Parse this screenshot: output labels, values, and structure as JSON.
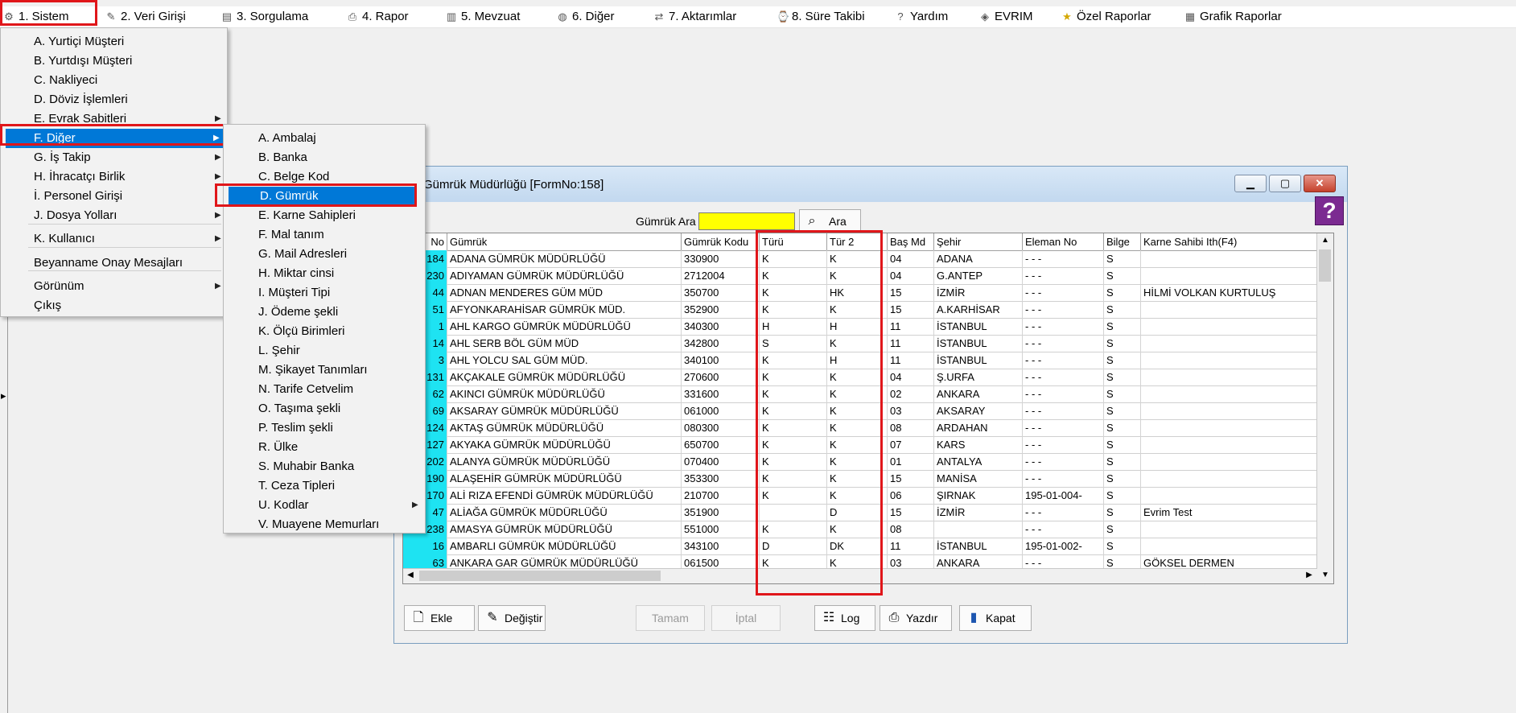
{
  "menubar": {
    "items": [
      {
        "label": "1.  Sistem",
        "icon": "system-icon"
      },
      {
        "label": "2.  Veri Girişi",
        "icon": "data-entry-icon"
      },
      {
        "label": "3.  Sorgulama",
        "icon": "query-icon"
      },
      {
        "label": "4.  Rapor",
        "icon": "printer-icon"
      },
      {
        "label": "5.  Mevzuat",
        "icon": "books-icon"
      },
      {
        "label": "6.  Diğer",
        "icon": "other-icon"
      },
      {
        "label": "7.  Aktarımlar",
        "icon": "transfer-icon"
      },
      {
        "label": "8. Süre Takibi",
        "icon": "timer-icon"
      },
      {
        "label": "Yardım",
        "icon": "help-icon"
      },
      {
        "label": "EVRIM",
        "icon": "evrim-icon"
      },
      {
        "label": "Özel Raporlar",
        "icon": "star-icon"
      },
      {
        "label": "Grafik Raporlar",
        "icon": "chart-icon"
      }
    ]
  },
  "system_menu": {
    "items": [
      {
        "label": "A.  Yurtiçi Müşteri"
      },
      {
        "label": "B.  Yurtdışı Müşteri"
      },
      {
        "label": "C.  Nakliyeci"
      },
      {
        "label": "D.  Döviz İşlemleri"
      },
      {
        "label": "E.  Evrak Sabitleri"
      },
      {
        "label": "F.  Diğer"
      },
      {
        "label": "G.  İş Takip"
      },
      {
        "label": "H.  İhracatçı Birlik"
      },
      {
        "label": "İ.    Personel Girişi"
      },
      {
        "label": "J.   Dosya Yolları"
      },
      {
        "label": "K.  Kullanıcı"
      },
      {
        "label": "Beyanname Onay Mesajları"
      },
      {
        "label": "Görünüm"
      },
      {
        "label": "Çıkış"
      }
    ]
  },
  "other_menu": {
    "items": [
      {
        "label": "A.  Ambalaj"
      },
      {
        "label": "B.  Banka"
      },
      {
        "label": "C.  Belge Kod"
      },
      {
        "label": "D.  Gümrük"
      },
      {
        "label": "E.  Karne Sahipleri"
      },
      {
        "label": "F.  Mal tanım"
      },
      {
        "label": "G.  Mail Adresleri"
      },
      {
        "label": "H.  Miktar cinsi"
      },
      {
        "label": "I.  Müşteri Tipi"
      },
      {
        "label": "J.  Ödeme şekli"
      },
      {
        "label": "K.  Ölçü Birimleri"
      },
      {
        "label": "L.  Şehir"
      },
      {
        "label": "M.  Şikayet Tanımları"
      },
      {
        "label": "N.  Tarife Cetvelim"
      },
      {
        "label": "O.  Taşıma şekli"
      },
      {
        "label": "P.  Teslim şekli"
      },
      {
        "label": "R.  Ülke"
      },
      {
        "label": "S.  Muhabir Banka"
      },
      {
        "label": "T.  Ceza Tipleri"
      },
      {
        "label": "U. Kodlar"
      },
      {
        "label": "V. Muayene Memurları"
      }
    ]
  },
  "window": {
    "title": "Gümrük Müdürlüğü [FormNo:158]",
    "help_glyph": "?"
  },
  "search": {
    "label": "Gümrük Ara",
    "value": "",
    "button_label": "Ara"
  },
  "grid": {
    "columns": [
      "No",
      "Gümrük",
      "Gümrük Kodu",
      "Türü",
      "Tür 2",
      "Baş Md",
      "Şehir",
      "Eleman No",
      "Bilge",
      "Karne Sahibi Ith(F4)"
    ],
    "rows": [
      [
        "184",
        "ADANA GÜMRÜK MÜDÜRLÜĞÜ",
        "330900",
        "K",
        "K",
        "04",
        "ADANA",
        "- - -",
        "S",
        ""
      ],
      [
        "230",
        "ADIYAMAN GÜMRÜK MÜDÜRLÜĞÜ",
        "2712004",
        "K",
        "K",
        "04",
        "G.ANTEP",
        "- - -",
        "S",
        ""
      ],
      [
        "44",
        "ADNAN MENDERES GÜM MÜD",
        "350700",
        "K",
        "HK",
        "15",
        "İZMİR",
        "- - -",
        "S",
        "HİLMİ VOLKAN KURTULUŞ"
      ],
      [
        "51",
        "AFYONKARAHİSAR GÜMRÜK MÜD.",
        "352900",
        "K",
        "K",
        "15",
        "A.KARHİSAR",
        "- - -",
        "S",
        ""
      ],
      [
        "1",
        "AHL KARGO GÜMRÜK MÜDÜRLÜĞÜ",
        "340300",
        "H",
        "H",
        "11",
        "İSTANBUL",
        "- - -",
        "S",
        ""
      ],
      [
        "14",
        "AHL SERB BÖL GÜM MÜD",
        "342800",
        "S",
        "K",
        "11",
        "İSTANBUL",
        "- - -",
        "S",
        ""
      ],
      [
        "3",
        "AHL YOLCU SAL GÜM MÜD.",
        "340100",
        "K",
        "H",
        "11",
        "İSTANBUL",
        "- - -",
        "S",
        ""
      ],
      [
        "131",
        "AKÇAKALE GÜMRÜK MÜDÜRLÜĞÜ",
        "270600",
        "K",
        "K",
        "04",
        "Ş.URFA",
        "- - -",
        "S",
        ""
      ],
      [
        "62",
        "AKINCI GÜMRÜK MÜDÜRLÜĞÜ",
        "331600",
        "K",
        "K",
        "02",
        "ANKARA",
        "- - -",
        "S",
        ""
      ],
      [
        "69",
        "AKSARAY GÜMRÜK MÜDÜRLÜĞÜ",
        "061000",
        "K",
        "K",
        "03",
        "AKSARAY",
        "- - -",
        "S",
        ""
      ],
      [
        "124",
        "AKTAŞ GÜMRÜK MÜDÜRLÜĞÜ",
        "080300",
        "K",
        "K",
        "08",
        "ARDAHAN",
        "- - -",
        "S",
        ""
      ],
      [
        "127",
        "AKYAKA GÜMRÜK MÜDÜRLÜĞÜ",
        "650700",
        "K",
        "K",
        "07",
        "KARS",
        "- - -",
        "S",
        ""
      ],
      [
        "202",
        "ALANYA GÜMRÜK MÜDÜRLÜĞÜ",
        "070400",
        "K",
        "K",
        "01",
        "ANTALYA",
        "- - -",
        "S",
        ""
      ],
      [
        "190",
        "ALAŞEHİR GÜMRÜK MÜDÜRLÜĞÜ",
        "353300",
        "K",
        "K",
        "15",
        "MANİSA",
        "- - -",
        "S",
        ""
      ],
      [
        "170",
        "ALİ RIZA EFENDİ GÜMRÜK MÜDÜRLÜĞÜ",
        "210700",
        "K",
        "K",
        "06",
        "ŞIRNAK",
        "195-01-004-",
        "S",
        ""
      ],
      [
        "47",
        "ALİAĞA GÜMRÜK MÜDÜRLÜĞÜ",
        "351900",
        "",
        "D",
        "15",
        "İZMİR",
        "- - -",
        "S",
        "Evrim Test"
      ],
      [
        "238",
        "AMASYA GÜMRÜK MÜDÜRLÜĞÜ",
        "551000",
        "K",
        "K",
        "08",
        "",
        "- - -",
        "S",
        ""
      ],
      [
        "16",
        "AMBARLI  GÜMRÜK MÜDÜRLÜĞÜ",
        "343100",
        "D",
        "DK",
        "11",
        "İSTANBUL",
        "195-01-002-",
        "S",
        ""
      ],
      [
        "63",
        "ANKARA GAR GÜMRÜK MÜDÜRLÜĞÜ",
        "061500",
        "K",
        "K",
        "03",
        "ANKARA",
        "- - -",
        "S",
        "GÖKSEL DERMEN"
      ],
      [
        "61",
        "ANKARA GÜMRÜK MÜDÜRLÜĞÜ",
        "061600",
        "K",
        "K",
        "03",
        "ANKARA",
        "- - -",
        "S",
        ""
      ]
    ]
  },
  "buttons": {
    "add": "Ekle",
    "edit": "Değiştir",
    "ok": "Tamam",
    "cancel": "İptal",
    "log": "Log",
    "print": "Yazdır",
    "close": "Kapat"
  },
  "colors": {
    "highlight": "#e0161a",
    "selection": "#0078d7",
    "search_bg": "#ffff00",
    "no_column": "#1ee3f2"
  }
}
